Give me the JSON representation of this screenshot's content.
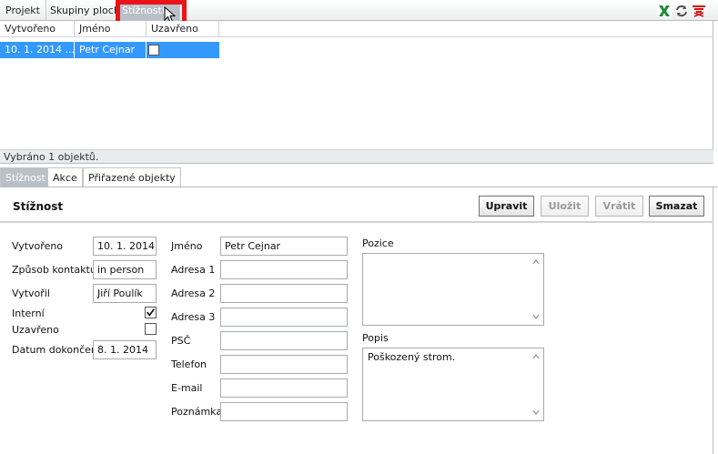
{
  "top_tabs": [
    {
      "label": "Projekt"
    },
    {
      "label": "Skupiny ploch"
    },
    {
      "label": "Stížnosti"
    }
  ],
  "toolbar": {
    "icons": [
      "excel-icon",
      "refresh-icon",
      "remove-filter-icon"
    ],
    "colors": {
      "excel": "#1f8a3b",
      "refresh": "#555555",
      "remove": "#cc1111"
    }
  },
  "grid": {
    "columns": [
      "Vytvořeno",
      "Jméno",
      "Uzavřeno"
    ],
    "rows": [
      {
        "created": "10. 1. 2014 ...",
        "name": "Petr Cejnar",
        "closed": false
      }
    ],
    "selection_color": "#3399ff"
  },
  "status": "Vybráno 1 objektů.",
  "detail_tabs": [
    {
      "label": "Stížnost"
    },
    {
      "label": "Akce"
    },
    {
      "label": "Přiřazené objekty"
    }
  ],
  "detail": {
    "title": "Stížnost",
    "buttons": {
      "edit": "Upravit",
      "save": "Uložit",
      "revert": "Vrátit",
      "delete": "Smazat"
    },
    "left_fields": {
      "created_label": "Vytvořeno",
      "created_value": "10. 1. 2014",
      "contact_label": "Způsob kontaktu",
      "contact_value": "in person",
      "creator_label": "Vytvořil",
      "creator_value": "Jiří Poulík",
      "internal_label": "Interní",
      "internal_checked": true,
      "closed_label": "Uzavřeno",
      "closed_checked": false,
      "completion_label": "Datum dokončení",
      "completion_value": "8. 1. 2014"
    },
    "middle_fields": {
      "name_label": "Jméno",
      "name_value": "Petr Cejnar",
      "addr1_label": "Adresa 1",
      "addr1_value": "",
      "addr2_label": "Adresa 2",
      "addr2_value": "",
      "addr3_label": "Adresa 3",
      "addr3_value": "",
      "zip_label": "PSČ",
      "zip_value": "",
      "phone_label": "Telefon",
      "phone_value": "",
      "email_label": "E-mail",
      "email_value": "",
      "note_label": "Poznámka",
      "note_value": ""
    },
    "right_fields": {
      "position_label": "Pozice",
      "position_value": "",
      "description_label": "Popis",
      "description_value": "Poškozený strom."
    }
  },
  "highlight_color": "#e8141a"
}
